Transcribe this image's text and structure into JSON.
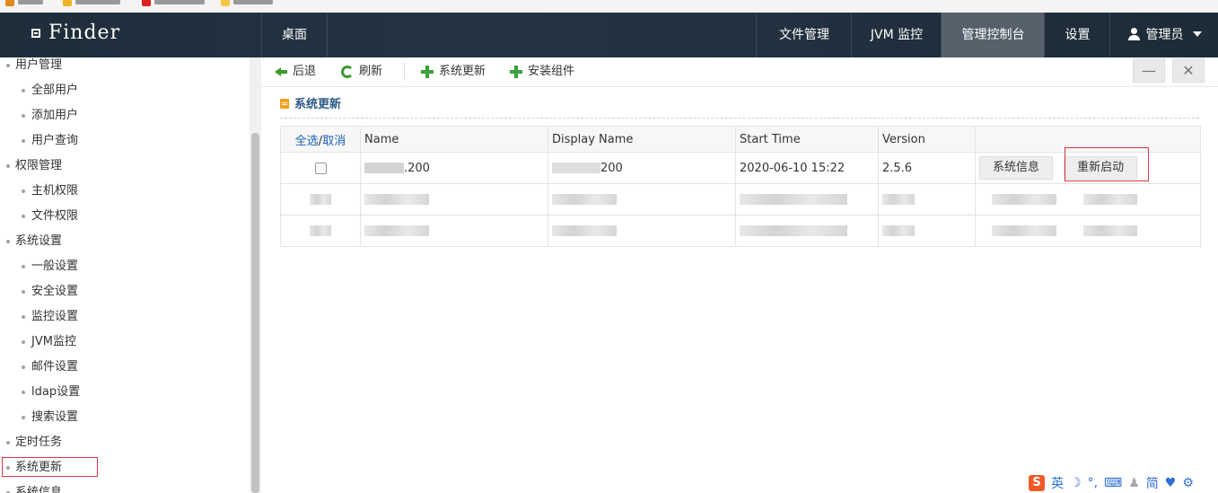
{
  "header": {
    "logo": "Finder",
    "desktop_tab": "桌面",
    "nav": [
      {
        "label": "文件管理"
      },
      {
        "label": "JVM 监控"
      },
      {
        "label": "管理控制台"
      },
      {
        "label": "设置"
      }
    ],
    "user": "管理员"
  },
  "sidebar": {
    "items": [
      {
        "label": "用户管理",
        "level": 1
      },
      {
        "label": "全部用户",
        "level": 2
      },
      {
        "label": "添加用户",
        "level": 2
      },
      {
        "label": "用户查询",
        "level": 2
      },
      {
        "label": "权限管理",
        "level": 1
      },
      {
        "label": "主机权限",
        "level": 2
      },
      {
        "label": "文件权限",
        "level": 2
      },
      {
        "label": "系统设置",
        "level": 1
      },
      {
        "label": "一般设置",
        "level": 2
      },
      {
        "label": "安全设置",
        "level": 2
      },
      {
        "label": "监控设置",
        "level": 2
      },
      {
        "label": "JVM监控",
        "level": 2
      },
      {
        "label": "邮件设置",
        "level": 2
      },
      {
        "label": "ldap设置",
        "level": 2
      },
      {
        "label": "搜索设置",
        "level": 2
      },
      {
        "label": "定时任务",
        "level": 1
      },
      {
        "label": "系统更新",
        "level": 1,
        "highlighted": true
      },
      {
        "label": "系统信息",
        "level": 1
      }
    ]
  },
  "toolbar": {
    "back": "后退",
    "refresh": "刷新",
    "system_update": "系统更新",
    "install_component": "安装组件",
    "minimize": "—",
    "close": "✕"
  },
  "section": {
    "title": "系统更新"
  },
  "table": {
    "select_all": "全选",
    "select_sep": "/",
    "select_cancel": "取消",
    "columns": [
      "Name",
      "Display Name",
      "Start Time",
      "Version"
    ],
    "rows": [
      {
        "name": ".200",
        "display_name": "200",
        "start_time": "2020-06-10 15:22",
        "version": "2.5.6",
        "info_button": "系统信息",
        "restart_button": "重新启动"
      }
    ]
  },
  "ime": {
    "badge": "S",
    "lang": "英",
    "mode": "简"
  },
  "colors": {
    "header_bg": "#1f2d3b",
    "active_nav": "#56616c",
    "accent_red": "#d9363e",
    "link_blue": "#1a5fb4",
    "section_title": "#2b5a85"
  }
}
